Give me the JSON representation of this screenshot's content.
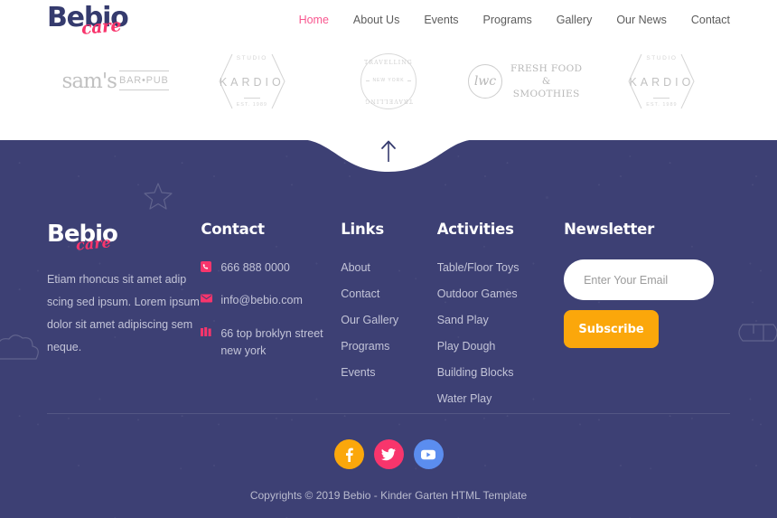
{
  "header": {
    "logo": {
      "main": "Bebio",
      "sub": "care"
    },
    "nav": [
      {
        "label": "Home",
        "active": true
      },
      {
        "label": "About Us",
        "active": false
      },
      {
        "label": "Events",
        "active": false
      },
      {
        "label": "Programs",
        "active": false
      },
      {
        "label": "Gallery",
        "active": false
      },
      {
        "label": "Our News",
        "active": false
      },
      {
        "label": "Contact",
        "active": false
      }
    ]
  },
  "brands": [
    {
      "id": "sams-bar-pub",
      "name": "sam's",
      "tag": "BAR•PUB"
    },
    {
      "id": "kardio-studio-1",
      "name": "KARDIO",
      "top": "STUDIO",
      "est": "EST. 1989"
    },
    {
      "id": "new-york-badge",
      "mid": "NEW YORK",
      "top": "TRAVELLING",
      "bottom": "TRAVELLING"
    },
    {
      "id": "fresh-food-smoothies",
      "mark": "lwc",
      "line1": "FRESH FOOD",
      "line2": "&",
      "line3": "SMOOTHIES"
    },
    {
      "id": "kardio-studio-2",
      "name": "KARDIO",
      "top": "STUDIO",
      "est": "EST. 1989"
    }
  ],
  "scroll_top": {
    "label": "Back to top",
    "icon": "arrow-up-icon"
  },
  "footer": {
    "logo": {
      "main": "Bebio",
      "sub": "care"
    },
    "about_text": "Etiam rhoncus sit amet adip scing sed ipsum. Lorem ipsum dolor sit amet adipiscing sem neque.",
    "contact": {
      "title": "Contact",
      "items": [
        {
          "icon": "phone-icon",
          "text": "666 888 0000"
        },
        {
          "icon": "envelope-icon",
          "text": "info@bebio.com"
        },
        {
          "icon": "map-marker-icon",
          "text": "66 top broklyn street new york"
        }
      ]
    },
    "links": {
      "title": "Links",
      "items": [
        "About",
        "Contact",
        "Our Gallery",
        "Programs",
        "Events"
      ]
    },
    "activities": {
      "title": "Activities",
      "items": [
        "Table/Floor Toys",
        "Outdoor Games",
        "Sand Play",
        "Play Dough",
        "Building Blocks",
        "Water Play"
      ]
    },
    "newsletter": {
      "title": "Newsletter",
      "placeholder": "Enter Your Email",
      "value": "",
      "button": "Subscribe"
    },
    "socials": [
      {
        "name": "facebook",
        "glyph": "f",
        "color": "#fba70b"
      },
      {
        "name": "twitter",
        "glyph": "twitter-bird-icon",
        "color": "#f8356c"
      },
      {
        "name": "youtube",
        "glyph": "youtube-icon",
        "color": "#5b8def"
      }
    ],
    "copyright": "Copyrights © 2019 Bebio - Kinder Garten HTML Template"
  },
  "colors": {
    "footer_bg": "#3d4074",
    "accent_pink": "#f8356c",
    "accent_orange": "#fba70b",
    "accent_blue": "#5b8def",
    "logo_navy": "#353b6e",
    "nav_active": "#f8578f"
  }
}
